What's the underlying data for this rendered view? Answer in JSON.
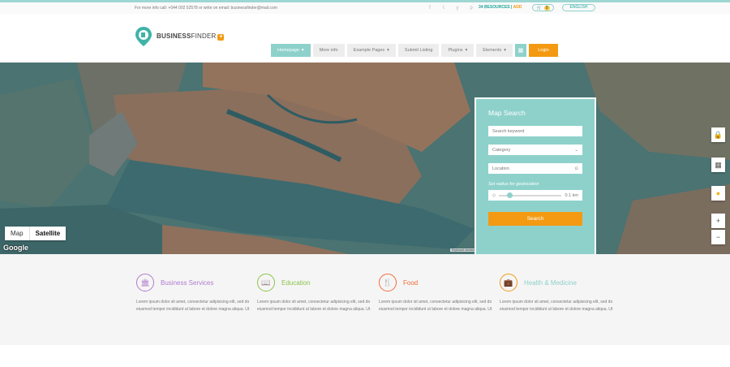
{
  "topbar": {
    "contact": "For more info call: +044 002 52578 or write on email: businessfinder@mail.com",
    "social": [
      "f",
      "t",
      "y",
      "p",
      "i"
    ],
    "resources_count": "34 RESOURCES",
    "add_label": "ADD",
    "cart_count": "0",
    "language": "ENGLISH"
  },
  "header": {
    "brand_bold": "BUSINESS",
    "brand_thin": "FINDER",
    "nav": [
      "Homepage",
      "More info",
      "Example Pages",
      "Submit Listing",
      "Plugins",
      "Elements"
    ],
    "login": "Login"
  },
  "map": {
    "type_map": "Map",
    "type_satellite": "Satellite",
    "google": "Google",
    "attribution": "Keyboard shortcuts  Map data ©2018 Imagery ©2018 DigitalGlobe, Map data  Terms of Use  Report a map error",
    "zoom_in": "+",
    "zoom_out": "−"
  },
  "map_search": {
    "title": "Map Search",
    "keyword_placeholder": "Search keyword",
    "category": "Category",
    "location": "Location",
    "radius_label": "Set radius for geolocation",
    "radius_value": "0.1 km",
    "search_button": "Search"
  },
  "categories": [
    {
      "title": "Business Services",
      "color": "#b07ccf",
      "desc": "Lorem ipsum dolor sit amet, consectetur adipisicing elit, sed do eiusmod tempor incididunt ut labore et dolore magna aliqua. Ut"
    },
    {
      "title": "Education",
      "color": "#8bc34a",
      "desc": "Lorem ipsum dolor sit amet, consectetur adipisicing elit, sed do eiusmod tempor incididunt ut labore et dolore magna aliqua. Ut"
    },
    {
      "title": "Food",
      "color": "#f26b3a",
      "desc": "Lorem ipsum dolor sit amet, consectetur adipisicing elit, sed do eiusmod tempor incididunt ut labore et dolore magna aliqua. Ut"
    },
    {
      "title": "Health & Medicine",
      "color": "#f39a12",
      "desc": "Lorem ipsum dolor sit amet, consectetur adipisicing elit, sed do eiusmod tempor incididunt ut labore et dolore magna aliqua. Ut"
    }
  ],
  "colors": {
    "accent": "#8ed1cb",
    "brand_orange": "#f39a12",
    "title_accent": "#1ea69a"
  }
}
